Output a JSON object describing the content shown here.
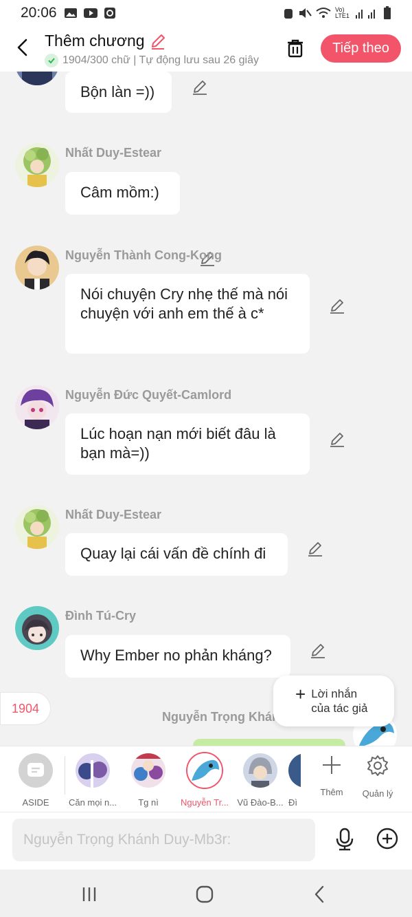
{
  "status_bar": {
    "time": "20:06",
    "network": "Vo) LTE1"
  },
  "header": {
    "title": "Thêm chương",
    "subtitle": "1904/300 chữ | Tự động lưu sau 26 giây",
    "next_label": "Tiếp theo"
  },
  "messages": [
    {
      "sender": "",
      "text": "Bộn làn =))"
    },
    {
      "sender": "Nhất Duy-Estear",
      "text": "Câm mồm:)"
    },
    {
      "sender": "Nguyễn Thành Cong-Kong",
      "text": "Nói chuyện Cry nhẹ thế mà nói chuyện với anh em thế à c*"
    },
    {
      "sender": "Nguyễn Đức Quyết-Camlord",
      "text": "Lúc hoạn nạn mới biết đâu là bạn mà=))"
    },
    {
      "sender": "Nhất Duy-Estear",
      "text": "Quay lại cái vấn đề chính đi"
    },
    {
      "sender": "Đình Tú-Cry",
      "text": "Why Ember no phản kháng?"
    }
  ],
  "word_count_badge": "1904",
  "author_note": {
    "line1": "Lời nhắn",
    "line2": "của tác giả"
  },
  "right_sender": "Nguyễn Trọng Khánh Duy-Mb3r",
  "characters": [
    {
      "name": "ASIDE"
    },
    {
      "name": "Căn mọi n..."
    },
    {
      "name": "Tg nì"
    },
    {
      "name": "Nguyễn Tr..."
    },
    {
      "name": "Vũ Đào-B..."
    },
    {
      "name": "Đì"
    }
  ],
  "tools": {
    "more": "Thêm",
    "manage": "Quản lý"
  },
  "input": {
    "placeholder": "Nguyễn Trọng Khánh Duy-Mb3r:"
  },
  "colors": {
    "accent": "#f25469",
    "bubble": "#ffffff",
    "background": "#f2f2f2"
  }
}
